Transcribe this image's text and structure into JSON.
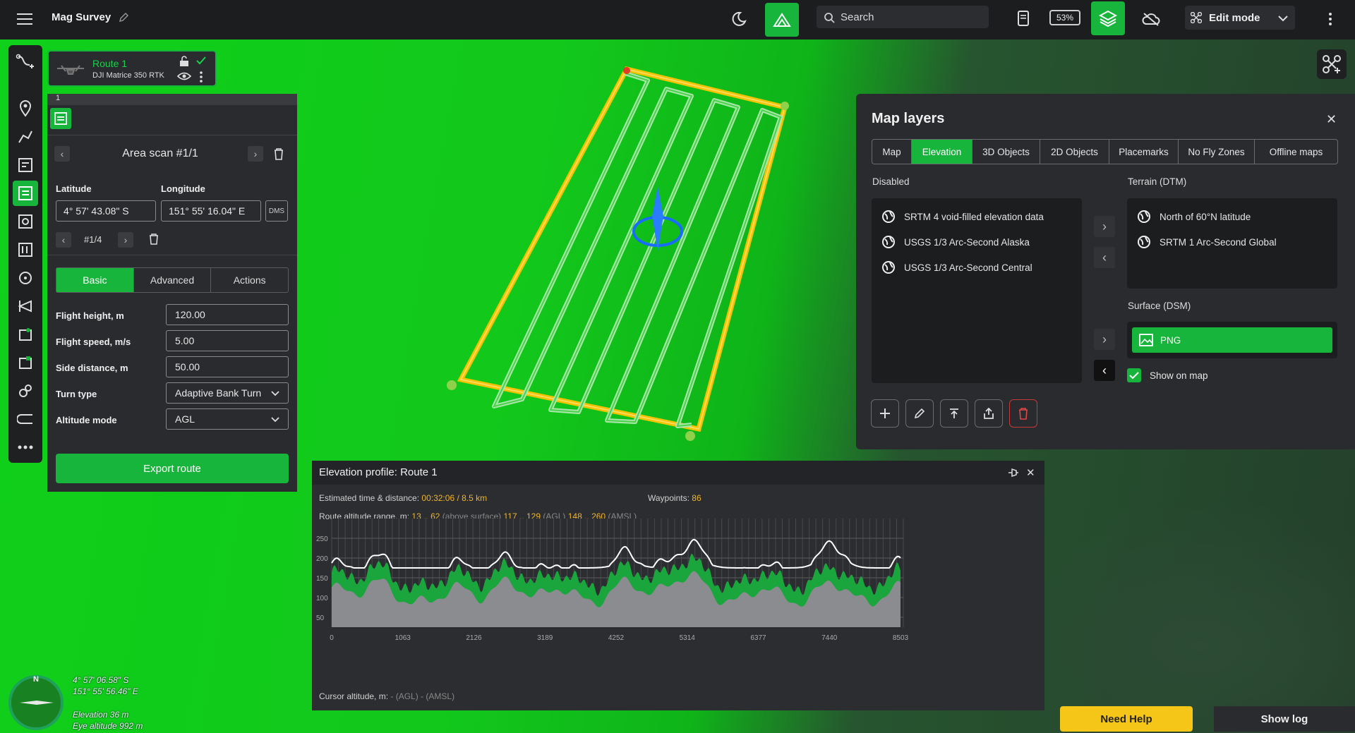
{
  "app": {
    "title": "Mag Survey",
    "search_placeholder": "Search",
    "battery": "53%",
    "edit_mode": "Edit mode"
  },
  "route_card": {
    "name": "Route 1",
    "drone": "DJI Matrice 350 RTK",
    "index": "1"
  },
  "scan": {
    "title": "Area scan #1/1",
    "latitude_label": "Latitude",
    "longitude_label": "Longitude",
    "latitude": "4° 57' 43.08\" S",
    "longitude": "151° 55' 16.04\" E",
    "dms": "DMS",
    "point_index": "#1/4",
    "tabs": [
      "Basic",
      "Advanced",
      "Actions"
    ],
    "params": [
      {
        "label": "Flight height, m",
        "value": "120.00"
      },
      {
        "label": "Flight speed, m/s",
        "value": "5.00"
      },
      {
        "label": "Side distance, m",
        "value": "50.00"
      },
      {
        "label": "Turn type",
        "value": "Adaptive Bank Turn"
      },
      {
        "label": "Altitude mode",
        "value": "AGL"
      }
    ],
    "export_label": "Export route"
  },
  "layers": {
    "title": "Map layers",
    "tabs": [
      "Map",
      "Elevation",
      "3D Objects",
      "2D Objects",
      "Placemarks",
      "No Fly Zones",
      "Offline maps"
    ],
    "active_tab": "Elevation",
    "disabled_label": "Disabled",
    "terrain_label": "Terrain (DTM)",
    "surface_label": "Surface (DSM)",
    "disabled_items": [
      "SRTM 4 void-filled elevation data",
      "USGS 1/3 Arc-Second Alaska",
      "USGS 1/3 Arc-Second Central"
    ],
    "terrain_items": [
      "North of 60°N latitude",
      "SRTM 1 Arc-Second Global"
    ],
    "surface_items": [
      "PNG"
    ],
    "show_on_map": "Show on map"
  },
  "elevation": {
    "title": "Elevation profile: Route 1",
    "est_label": "Estimated time & distance:",
    "est_value": "00:32:06 / 8.5 km",
    "waypoints_label": "Waypoints:",
    "waypoints_value": "86",
    "range_label": "Route altitude range, m:",
    "range_surface": "13 .. 62",
    "range_surface_note": "(above surface)",
    "range_agl": "117 .. 129",
    "range_agl_note": "(AGL)",
    "range_amsl": "148 .. 260",
    "range_amsl_note": "(AMSL)",
    "cursor_label": "Cursor altitude, m:",
    "cursor_value": "- (AGL) - (AMSL)",
    "y_ticks": [
      "250",
      "200",
      "150",
      "100",
      "50"
    ],
    "x_ticks": [
      "0",
      "1063",
      "2126",
      "3189",
      "4252",
      "5314",
      "6377",
      "7440",
      "8503"
    ]
  },
  "overlay": {
    "lat": "4° 57' 06.58\" S",
    "lon": "151° 55' 56.46\" E",
    "elevation": "Elevation 36 m",
    "eye_altitude": "Eye altitude 992 m",
    "compass_n": "N"
  },
  "buttons": {
    "need_help": "Need Help",
    "show_log": "Show log"
  },
  "colors": {
    "accent": "#17b53c",
    "warning": "#f5c518",
    "value": "#f0b429"
  }
}
